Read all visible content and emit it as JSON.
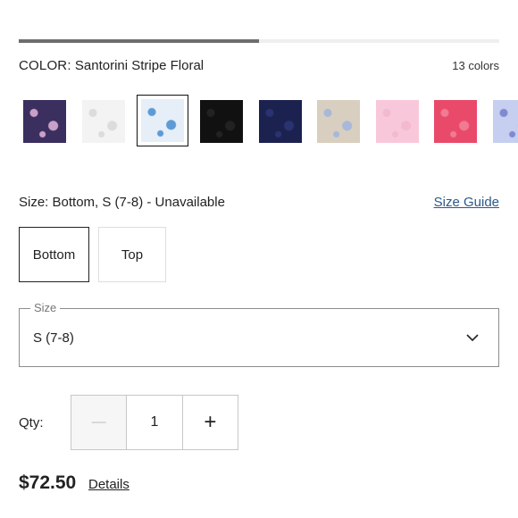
{
  "progress": {
    "fraction": 0.5
  },
  "color": {
    "label": "COLOR:",
    "selected": "Santorini Stripe Floral",
    "count_text": "13 colors",
    "swatches": [
      {
        "name": "navy-floral",
        "color": "#3a2f5e",
        "accent": "#c9a0c8"
      },
      {
        "name": "white-smocked",
        "color": "#f3f3f3",
        "accent": "#dcdcdc"
      },
      {
        "name": "santorini-stripe-floral",
        "color": "#e6eef8",
        "accent": "#5c9bd6",
        "selected": true
      },
      {
        "name": "black",
        "color": "#111111",
        "accent": "#222222"
      },
      {
        "name": "navy",
        "color": "#1b2250",
        "accent": "#2a3270"
      },
      {
        "name": "multicolor-floral",
        "color": "#d9cfc0",
        "accent": "#a8b8d8"
      },
      {
        "name": "light-pink",
        "color": "#f8c8da",
        "accent": "#f3b9cf"
      },
      {
        "name": "coral-pink",
        "color": "#e94a6a",
        "accent": "#f07b92"
      },
      {
        "name": "blue-print",
        "color": "#c7cff0",
        "accent": "#7f8bd0"
      }
    ]
  },
  "size": {
    "label": "Size:",
    "value_text": "Bottom, S (7-8) - Unavailable",
    "guide_label": "Size Guide",
    "options": [
      "Bottom",
      "Top"
    ],
    "select_legend": "Size",
    "select_value": "S (7-8)"
  },
  "qty": {
    "label": "Qty:",
    "minus": "—",
    "value": "1",
    "plus": "+"
  },
  "price": {
    "amount": "$72.50",
    "details_label": "Details"
  }
}
